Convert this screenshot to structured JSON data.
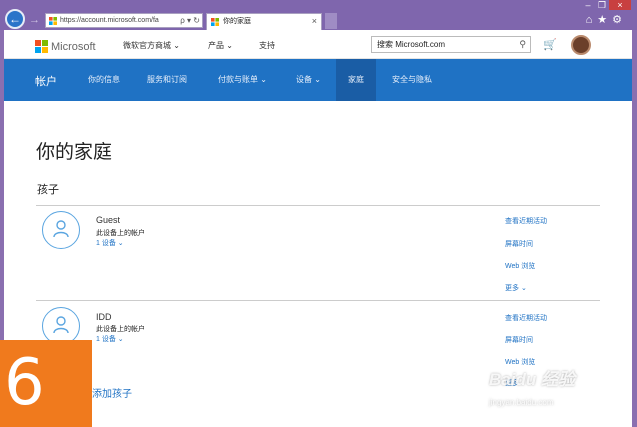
{
  "browser": {
    "address": "https://account.microsoft.com/fa",
    "address_controls": "ρ ▾ ↻",
    "tab_title": "你的家庭",
    "tab_close": "×",
    "back_glyph": "←",
    "forward_glyph": "→",
    "chrome_icons": "⌂★⚙",
    "window_controls": [
      "–",
      "❐",
      "×"
    ]
  },
  "topbar": {
    "logo_text": "Microsoft",
    "links": [
      "微软官方商城 ⌄",
      "产品 ⌄",
      "支持"
    ],
    "search_placeholder": "搜索 Microsoft.com",
    "search_icon_glyph": "⚲",
    "cart_glyph": "🛒"
  },
  "nav": {
    "brand": "帐户",
    "items": [
      "你的信息",
      "服务和订阅",
      "付款与账单 ⌄",
      "设备 ⌄",
      "家庭",
      "安全与隐私"
    ]
  },
  "main": {
    "title": "你的家庭",
    "section": "孩子",
    "children": [
      {
        "name": "Guest",
        "subtitle": "此设备上的帐户",
        "devices": "1 设备 ⌄",
        "links": [
          "查看近期活动",
          "屏幕时间",
          "Web 浏览",
          "更多 ⌄"
        ]
      },
      {
        "name": "IDD",
        "subtitle": "此设备上的帐户",
        "devices": "1 设备 ⌄",
        "links": [
          "查看近期活动",
          "屏幕时间",
          "Web 浏览",
          "更多"
        ]
      }
    ],
    "add_child": "添加孩子"
  },
  "overlay": {
    "step_number": "6",
    "watermark": "Baidu 经验",
    "watermark_url": "jingyan.baidu.com"
  },
  "colors": {
    "accent": "#1f72c4",
    "nav_bg": "#1f72c4",
    "window_frame": "#7f66ad",
    "badge": "#f07a1d"
  }
}
